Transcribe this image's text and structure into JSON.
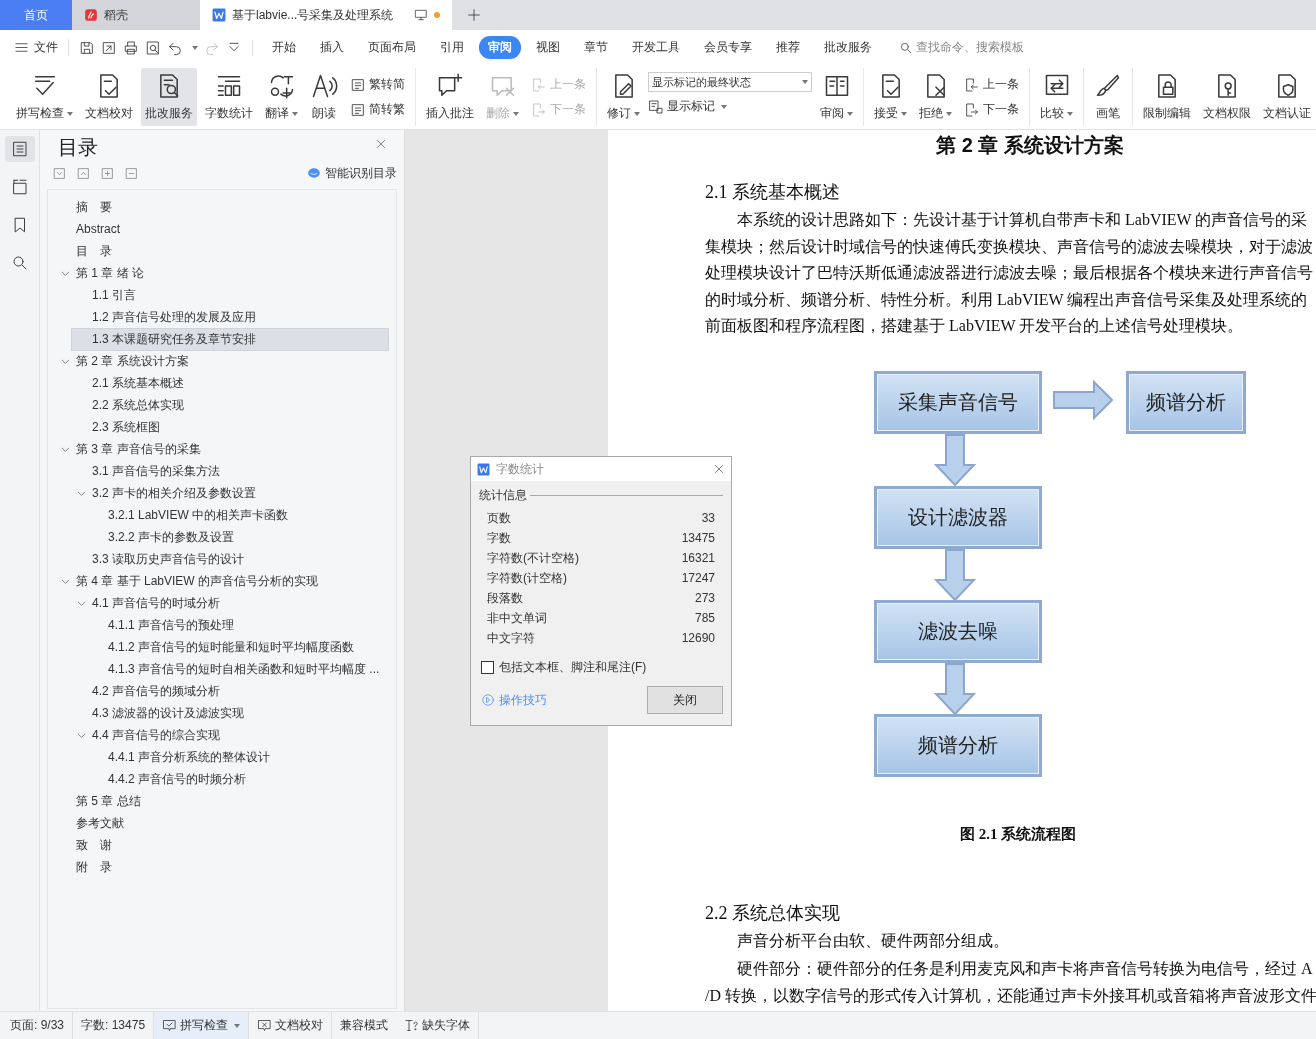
{
  "tabs": [
    {
      "kind": "home",
      "label": "首页",
      "selected": false
    },
    {
      "kind": "docer",
      "label": "稻壳",
      "selected": false
    },
    {
      "kind": "document",
      "label": "基于labvie...号采集及处理系统",
      "selected": true,
      "unsaved": true
    }
  ],
  "menu": {
    "file": "文件",
    "quick_access": [
      {
        "kind": "save",
        "disabled": false
      },
      {
        "kind": "export",
        "disabled": false
      },
      {
        "kind": "print",
        "disabled": false
      },
      {
        "kind": "preview",
        "disabled": false
      },
      {
        "kind": "undo",
        "disabled": false
      },
      {
        "kind": "redo",
        "disabled": true
      },
      {
        "kind": "customize",
        "disabled": false
      }
    ],
    "tabs": [
      {
        "label": "开始",
        "selected": false
      },
      {
        "label": "插入",
        "selected": false
      },
      {
        "label": "页面布局",
        "selected": false
      },
      {
        "label": "引用",
        "selected": false
      },
      {
        "label": "审阅",
        "selected": true
      },
      {
        "label": "视图",
        "selected": false
      },
      {
        "label": "章节",
        "selected": false
      },
      {
        "label": "开发工具",
        "selected": false
      },
      {
        "label": "会员专享",
        "selected": false
      },
      {
        "label": "推荐",
        "selected": false
      },
      {
        "label": "批改服务",
        "selected": false
      }
    ],
    "search": {
      "placeholder": "查找命令、搜索模板"
    }
  },
  "ribbon": [
    {
      "items": [
        {
          "kind": "large",
          "label": "拼写检查",
          "caret": true,
          "disabled": false,
          "selected": false
        },
        {
          "kind": "large",
          "label": "文档校对",
          "caret": false,
          "disabled": false,
          "selected": false
        },
        {
          "kind": "large",
          "label": "批改服务",
          "caret": false,
          "disabled": false,
          "selected": true
        },
        {
          "kind": "large",
          "label": "字数统计",
          "caret": false,
          "disabled": false,
          "selected": false
        },
        {
          "kind": "large",
          "label": "翻译",
          "caret": true,
          "disabled": false,
          "selected": false
        },
        {
          "kind": "large",
          "label": "朗读",
          "caret": false,
          "disabled": false,
          "selected": false
        },
        {
          "kind": "stack",
          "items": [
            {
              "label": "繁转简",
              "disabled": false
            },
            {
              "label": "简转繁",
              "disabled": false
            }
          ]
        }
      ]
    },
    {
      "items": [
        {
          "kind": "large",
          "label": "插入批注",
          "caret": false,
          "disabled": false,
          "selected": false
        },
        {
          "kind": "large",
          "label": "删除",
          "caret": true,
          "disabled": true,
          "selected": false
        },
        {
          "kind": "stack",
          "items": [
            {
              "label": "上一条",
              "disabled": true
            },
            {
              "label": "下一条",
              "disabled": true
            }
          ]
        }
      ]
    },
    {
      "items": [
        {
          "kind": "large",
          "label": "修订",
          "caret": true,
          "disabled": false,
          "selected": false
        },
        {
          "kind": "select",
          "value": "显示标记的最终状态",
          "sub": {
            "label": "显示标记",
            "caret": true
          }
        },
        {
          "kind": "large",
          "label": "审阅",
          "caret": true,
          "disabled": false,
          "selected": false
        }
      ]
    },
    {
      "items": [
        {
          "kind": "large",
          "label": "接受",
          "caret": true,
          "disabled": false,
          "selected": false
        },
        {
          "kind": "large",
          "label": "拒绝",
          "caret": true,
          "disabled": false,
          "selected": false
        },
        {
          "kind": "stack",
          "items": [
            {
              "label": "上一条",
              "disabled": false
            },
            {
              "label": "下一条",
              "disabled": false
            }
          ]
        }
      ]
    },
    {
      "items": [
        {
          "kind": "large",
          "label": "比较",
          "caret": true,
          "disabled": false,
          "selected": false
        }
      ]
    },
    {
      "items": [
        {
          "kind": "large",
          "label": "画笔",
          "caret": false,
          "disabled": false,
          "selected": false
        }
      ]
    },
    {
      "items": [
        {
          "kind": "large",
          "label": "限制编辑",
          "caret": false,
          "disabled": false,
          "selected": false
        },
        {
          "kind": "large",
          "label": "文档权限",
          "caret": false,
          "disabled": false,
          "selected": false
        },
        {
          "kind": "large",
          "label": "文档认证",
          "caret": false,
          "disabled": false,
          "selected": false
        }
      ]
    }
  ],
  "side_rail": [
    {
      "kind": "outline",
      "selected": true
    },
    {
      "kind": "structure",
      "selected": false
    },
    {
      "kind": "bookmark",
      "selected": false
    },
    {
      "kind": "search",
      "selected": false
    }
  ],
  "nav": {
    "title": "目录",
    "smart_button": "智能识别目录",
    "tree": [
      {
        "label": "摘　要",
        "selected": false
      },
      {
        "label": "Abstract",
        "selected": false
      },
      {
        "label": "目　录",
        "selected": false
      },
      {
        "label": "第 1 章  绪  论",
        "selected": false,
        "expanded": true,
        "children": [
          {
            "label": "1.1  引言",
            "selected": false
          },
          {
            "label": "1.2  声音信号处理的发展及应用",
            "selected": false
          },
          {
            "label": "1.3  本课题研究任务及章节安排",
            "selected": true
          }
        ]
      },
      {
        "label": "第 2 章  系统设计方案",
        "selected": false,
        "expanded": true,
        "children": [
          {
            "label": "2.1 系统基本概述",
            "selected": false
          },
          {
            "label": "2.2 系统总体实现",
            "selected": false
          },
          {
            "label": "2.3 系统框图",
            "selected": false
          }
        ]
      },
      {
        "label": "第 3 章  声音信号的采集",
        "selected": false,
        "expanded": true,
        "children": [
          {
            "label": "3.1  声音信号的采集方法",
            "selected": false
          },
          {
            "label": "3.2  声卡的相关介绍及参数设置",
            "selected": false,
            "expanded": true,
            "children": [
              {
                "label": "3.2.1 LabVIEW 中的相关声卡函数",
                "selected": false
              },
              {
                "label": "3.2.2 声卡的参数及设置",
                "selected": false
              }
            ]
          },
          {
            "label": "3.3  读取历史声音信号的设计",
            "selected": false
          }
        ]
      },
      {
        "label": "第 4 章  基于 LabVIEW 的声音信号分析的实现",
        "selected": false,
        "expanded": true,
        "children": [
          {
            "label": "4.1 声音信号的时域分析",
            "selected": false,
            "expanded": true,
            "children": [
              {
                "label": "4.1.1 声音信号的预处理",
                "selected": false
              },
              {
                "label": "4.1.2 声音信号的短时能量和短时平均幅度函数",
                "selected": false
              },
              {
                "label": "4.1.3 声音信号的短时自相关函数和短时平均幅度 ...",
                "selected": false
              }
            ]
          },
          {
            "label": "4.2 声音信号的频域分析",
            "selected": false
          },
          {
            "label": "4.3 滤波器的设计及滤波实现",
            "selected": false
          },
          {
            "label": "4.4 声音信号的综合实现",
            "selected": false,
            "expanded": true,
            "children": [
              {
                "label": "4.4.1 声音分析系统的整体设计",
                "selected": false
              },
              {
                "label": "4.4.2 声音信号的时频分析",
                "selected": false
              }
            ]
          }
        ]
      },
      {
        "label": "第 5 章  总结",
        "selected": false
      },
      {
        "label": "参考文献",
        "selected": false
      },
      {
        "label": "致　谢",
        "selected": false
      },
      {
        "label": "附　录",
        "selected": false
      }
    ]
  },
  "document": {
    "blocks": [
      {
        "kind": "chapter",
        "text": "第 2 章  系统设计方案"
      },
      {
        "kind": "heading",
        "text": "2.1 系统基本概述"
      },
      {
        "kind": "paragraph",
        "lines": [
          "本系统的设计思路如下：先设计基于计算机自带声卡和 LabVIEW 的声音信号的采",
          "集模块；然后设计时域信号的快速傅氏变换模块、声音信号的滤波去噪模块，对于滤波",
          "处理模块设计了巴特沃斯低通滤波器进行滤波去噪；最后根据各个模块来进行声音信号",
          "的时域分析、频谱分析、特性分析。利用 LabVIEW 编程出声音信号采集及处理系统的",
          "前面板图和程序流程图，搭建基于 LabVIEW 开发平台的上述信号处理模块。"
        ]
      },
      {
        "kind": "flowchart",
        "column": [
          "采集声音信号",
          "设计滤波器",
          "滤波去噪",
          "频谱分析"
        ],
        "side": "频谱分析"
      },
      {
        "kind": "caption",
        "text": "图 2.1    系统流程图"
      },
      {
        "kind": "heading",
        "text": "2.2 系统总体实现"
      },
      {
        "kind": "paragraph",
        "lines": [
          "声音分析平台由软、硬件两部分组成。"
        ]
      },
      {
        "kind": "paragraph",
        "lines": [
          "硬件部分：硬件部分的任务是利用麦克风和声卡将声音信号转换为电信号，经过 A",
          "/D 转换，以数字信号的形式传入计算机，还能通过声卡外接耳机或音箱将声音波形文件"
        ]
      }
    ]
  },
  "dialog": {
    "title": "字数统计",
    "group": "统计信息",
    "rows": [
      {
        "label": "页数",
        "value": "33"
      },
      {
        "label": "字数",
        "value": "13475"
      },
      {
        "label": "字符数(不计空格)",
        "value": "16321"
      },
      {
        "label": "字符数(计空格)",
        "value": "17247"
      },
      {
        "label": "段落数",
        "value": "273"
      },
      {
        "label": "非中文单词",
        "value": "785"
      },
      {
        "label": "中文字符",
        "value": "12690"
      }
    ],
    "checkbox": {
      "label": "包括文本框、脚注和尾注(F)",
      "checked": false
    },
    "link": "操作技巧",
    "button": "关闭"
  },
  "status_bar": {
    "page": "页面: 9/33",
    "words": "字数: 13475",
    "items": [
      {
        "kind": "spellcheck",
        "label": "拼写检查",
        "caret": true,
        "selected": true
      },
      {
        "kind": "proofread",
        "label": "文档校对",
        "caret": false,
        "selected": false
      },
      {
        "kind": "plain",
        "label": "兼容模式",
        "caret": false,
        "selected": false
      },
      {
        "kind": "font",
        "label": "缺失字体",
        "caret": false,
        "selected": false
      }
    ]
  }
}
